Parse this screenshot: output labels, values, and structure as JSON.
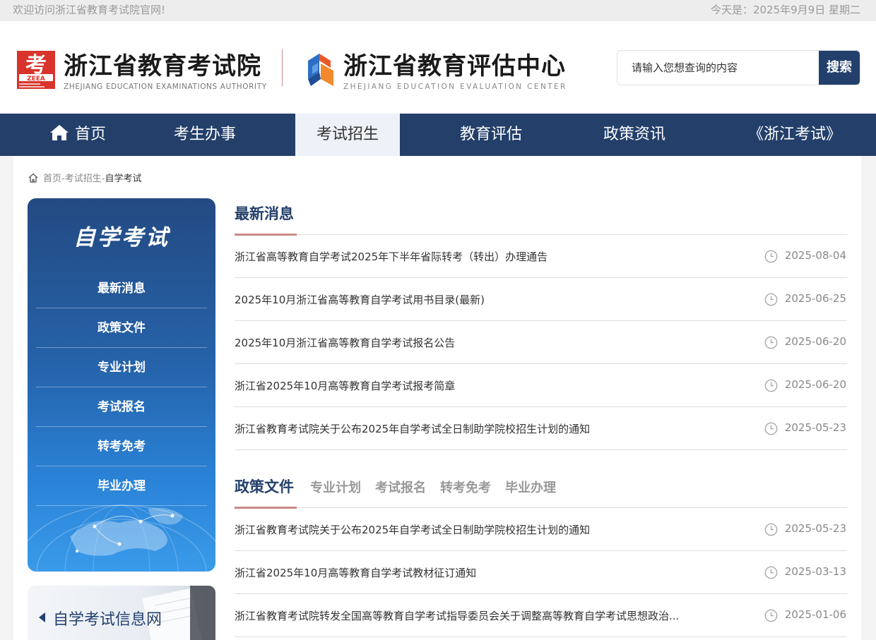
{
  "topbar": {
    "welcome": "欢迎访问浙江省教育考试院官网!",
    "date": "今天是：2025年9月9日 星期二"
  },
  "header": {
    "brand1_cn": "浙江省教育考试院",
    "brand1_en": "ZHEJIANG EDUCATION EXAMINATIONS AUTHORITY",
    "brand2_cn": "浙江省教育评估中心",
    "brand2_en": "ZHEJIANG EDUCATION EVALUATION CENTER",
    "logo1_icon": "zeea-logo-icon",
    "logo2_icon": "evaluation-center-logo-icon"
  },
  "search": {
    "placeholder": "请输入您想查询的内容",
    "button": "搜索"
  },
  "nav": [
    {
      "label": "首页"
    },
    {
      "label": "考生办事"
    },
    {
      "label": "考试招生",
      "active": true
    },
    {
      "label": "教育评估"
    },
    {
      "label": "政策资讯"
    },
    {
      "label": "《浙江考试》"
    }
  ],
  "breadcrumb": {
    "home": "首页",
    "sep1": "-",
    "level2": "考试招生",
    "sep2": "-",
    "current": "自学考试"
  },
  "sidebar": {
    "title": "自学考试",
    "items": [
      "最新消息",
      "政策文件",
      "专业计划",
      "考试报名",
      "转考免考",
      "毕业办理"
    ]
  },
  "infobox": {
    "label": "自学考试信息网"
  },
  "latest": {
    "title": "最新消息",
    "items": [
      {
        "title": "浙江省高等教育自学考试2025年下半年省际转考（转出）办理通告",
        "date": "2025-08-04"
      },
      {
        "title": "2025年10月浙江省高等教育自学考试用书目录(最新)",
        "date": "2025-06-25"
      },
      {
        "title": "2025年10月浙江省高等教育自学考试报名公告",
        "date": "2025-06-20"
      },
      {
        "title": "浙江省2025年10月高等教育自学考试报考简章",
        "date": "2025-06-20"
      },
      {
        "title": "浙江省教育考试院关于公布2025年自学考试全日制助学院校招生计划的通知",
        "date": "2025-05-23"
      }
    ]
  },
  "policy": {
    "tabs": [
      "政策文件",
      "专业计划",
      "考试报名",
      "转考免考",
      "毕业办理"
    ],
    "items": [
      {
        "title": "浙江省教育考试院关于公布2025年自学考试全日制助学院校招生计划的通知",
        "date": "2025-05-23"
      },
      {
        "title": "浙江省2025年10月高等教育自学考试教材征订通知",
        "date": "2025-03-13"
      },
      {
        "title": "浙江省教育考试院转发全国高等教育自学考试指导委员会关于调整高等教育自学考试思想政治...",
        "date": "2025-01-06"
      }
    ]
  },
  "colors": {
    "navy": "#233f6a",
    "accent": "#c98a82"
  }
}
